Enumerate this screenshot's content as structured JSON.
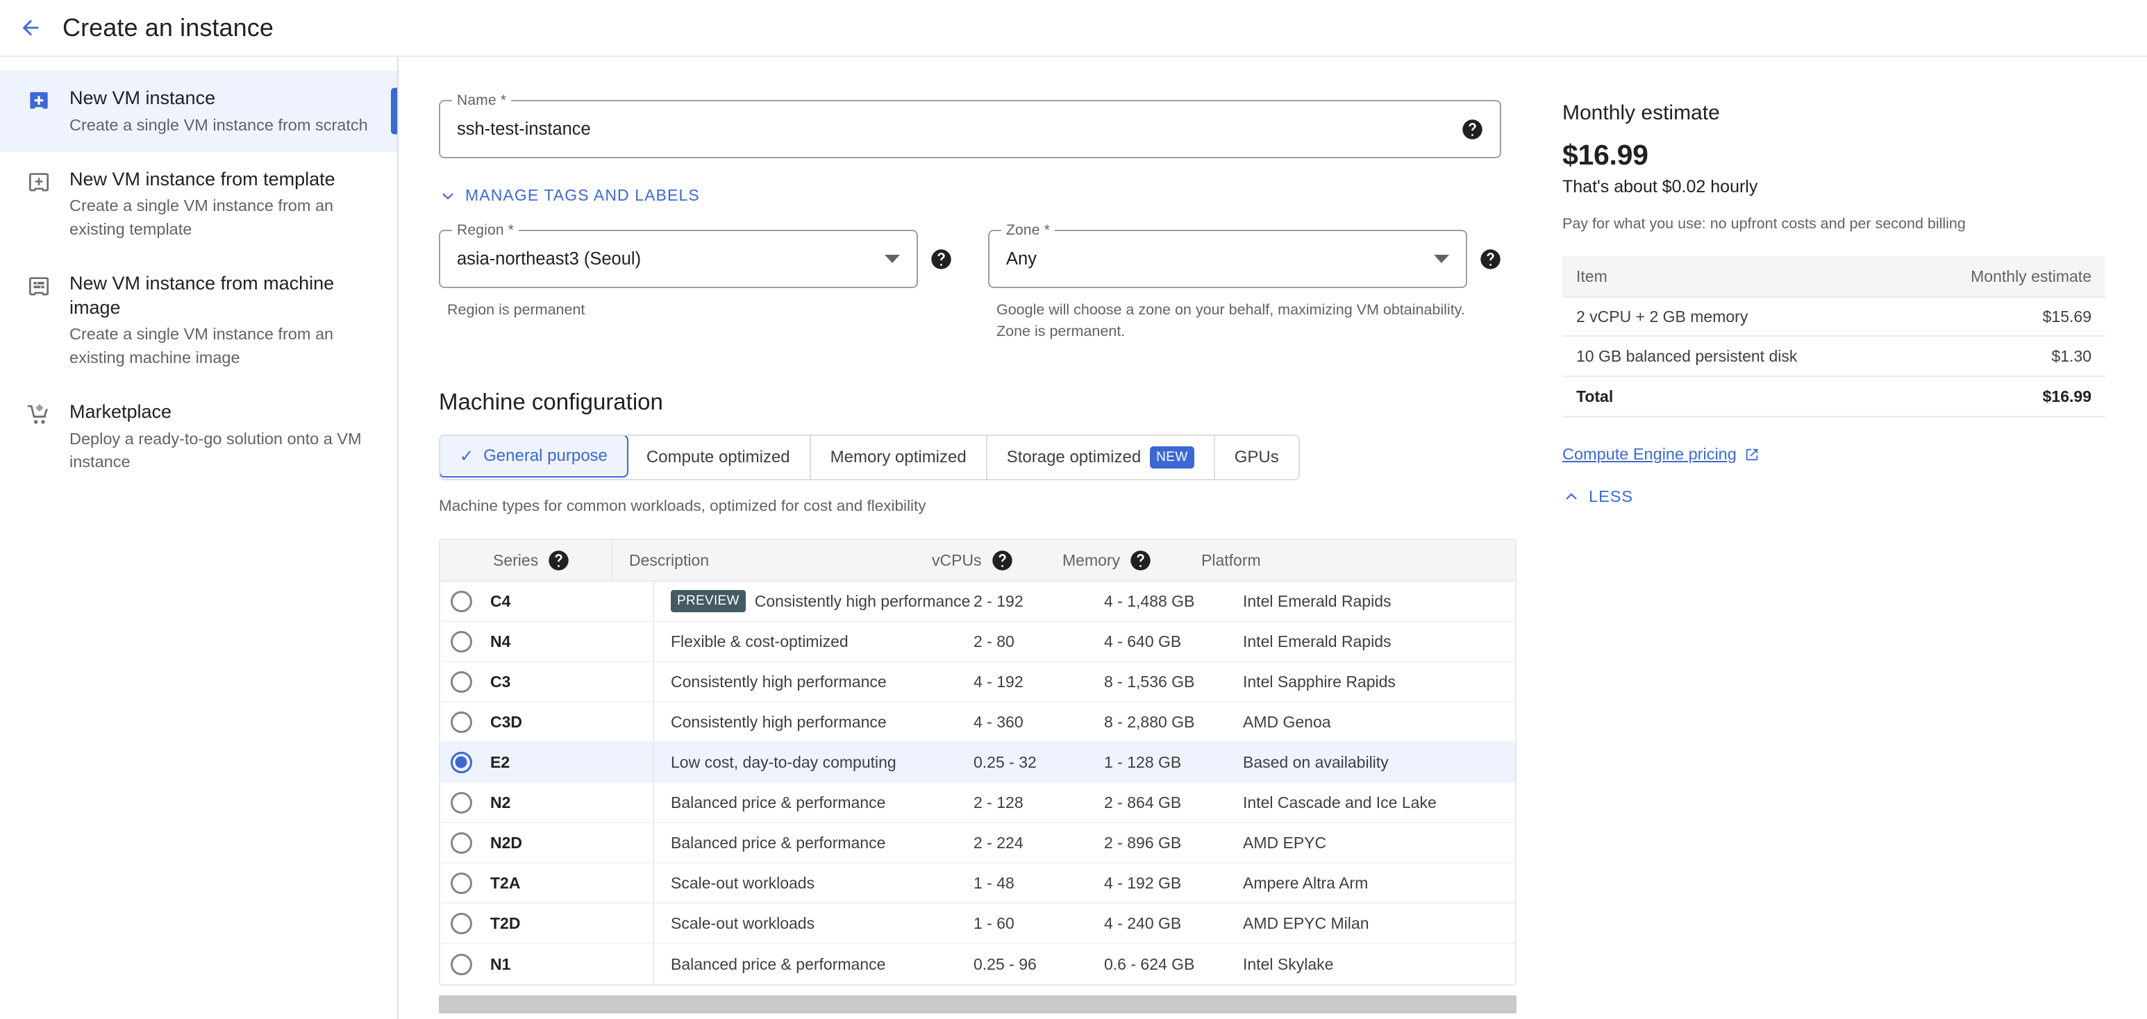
{
  "header": {
    "title": "Create an instance",
    "back_icon": "arrow-back-icon"
  },
  "sidebar": {
    "items": [
      {
        "icon": "vm-add-icon",
        "title": "New VM instance",
        "desc": "Create a single VM instance from scratch",
        "active": true
      },
      {
        "icon": "vm-template-icon",
        "title": "New VM instance from template",
        "desc": "Create a single VM instance from an existing template",
        "active": false
      },
      {
        "icon": "machine-image-icon",
        "title": "New VM instance from machine image",
        "desc": "Create a single VM instance from an existing machine image",
        "active": false
      },
      {
        "icon": "shopping-cart-icon",
        "title": "Marketplace",
        "desc": "Deploy a ready-to-go solution onto a VM instance",
        "active": false
      }
    ]
  },
  "form": {
    "name": {
      "label": "Name *",
      "value": "ssh-test-instance",
      "help_icon": "help-icon"
    },
    "manage_tags_link": "MANAGE TAGS AND LABELS",
    "region": {
      "label": "Region *",
      "value": "asia-northeast3 (Seoul)",
      "hint": "Region is permanent",
      "help_icon": "help-icon"
    },
    "zone": {
      "label": "Zone *",
      "value": "Any",
      "hint": "Google will choose a zone on your behalf, maximizing VM obtainability. Zone is permanent.",
      "help_icon": "help-icon"
    }
  },
  "machine_config": {
    "title": "Machine configuration",
    "tabs": [
      {
        "label": "General purpose",
        "selected": true,
        "badge": null
      },
      {
        "label": "Compute optimized",
        "selected": false,
        "badge": null
      },
      {
        "label": "Memory optimized",
        "selected": false,
        "badge": null
      },
      {
        "label": "Storage optimized",
        "selected": false,
        "badge": "NEW"
      },
      {
        "label": "GPUs",
        "selected": false,
        "badge": null
      }
    ],
    "tabs_hint": "Machine types for common workloads, optimized for cost and flexibility",
    "table": {
      "columns": [
        "Series",
        "Description",
        "vCPUs",
        "Memory",
        "Platform"
      ],
      "rows": [
        {
          "series": "C4",
          "badge": "PREVIEW",
          "description": "Consistently high performance",
          "vcpus": "2 - 192",
          "memory": "4 - 1,488 GB",
          "platform": "Intel Emerald Rapids",
          "selected": false
        },
        {
          "series": "N4",
          "badge": null,
          "description": "Flexible & cost-optimized",
          "vcpus": "2 - 80",
          "memory": "4 - 640 GB",
          "platform": "Intel Emerald Rapids",
          "selected": false
        },
        {
          "series": "C3",
          "badge": null,
          "description": "Consistently high performance",
          "vcpus": "4 - 192",
          "memory": "8 - 1,536 GB",
          "platform": "Intel Sapphire Rapids",
          "selected": false
        },
        {
          "series": "C3D",
          "badge": null,
          "description": "Consistently high performance",
          "vcpus": "4 - 360",
          "memory": "8 - 2,880 GB",
          "platform": "AMD Genoa",
          "selected": false
        },
        {
          "series": "E2",
          "badge": null,
          "description": "Low cost, day-to-day computing",
          "vcpus": "0.25 - 32",
          "memory": "1 - 128 GB",
          "platform": "Based on availability",
          "selected": true
        },
        {
          "series": "N2",
          "badge": null,
          "description": "Balanced price & performance",
          "vcpus": "2 - 128",
          "memory": "2 - 864 GB",
          "platform": "Intel Cascade and Ice Lake",
          "selected": false
        },
        {
          "series": "N2D",
          "badge": null,
          "description": "Balanced price & performance",
          "vcpus": "2 - 224",
          "memory": "2 - 896 GB",
          "platform": "AMD EPYC",
          "selected": false
        },
        {
          "series": "T2A",
          "badge": null,
          "description": "Scale-out workloads",
          "vcpus": "1 - 48",
          "memory": "4 - 192 GB",
          "platform": "Ampere Altra Arm",
          "selected": false
        },
        {
          "series": "T2D",
          "badge": null,
          "description": "Scale-out workloads",
          "vcpus": "1 - 60",
          "memory": "4 - 240 GB",
          "platform": "AMD EPYC Milan",
          "selected": false
        },
        {
          "series": "N1",
          "badge": null,
          "description": "Balanced price & performance",
          "vcpus": "0.25 - 96",
          "memory": "0.6 - 624 GB",
          "platform": "Intel Skylake",
          "selected": false
        }
      ]
    }
  },
  "estimate": {
    "title": "Monthly estimate",
    "price": "$16.99",
    "hourly": "That's about $0.02 hourly",
    "note": "Pay for what you use: no upfront costs and per second billing",
    "col_item": "Item",
    "col_estimate": "Monthly estimate",
    "rows": [
      {
        "item": "2 vCPU + 2 GB memory",
        "value": "$15.69"
      },
      {
        "item": "10 GB balanced persistent disk",
        "value": "$1.30"
      },
      {
        "item": "Total",
        "value": "$16.99"
      }
    ],
    "pricing_link": "Compute Engine pricing",
    "less_link": "LESS"
  },
  "colors": {
    "accent": "#3c68d4",
    "accent_bg": "#eef3fd",
    "badge_preview": "#455a64",
    "text_primary": "#202124",
    "text_secondary": "#5f6368"
  }
}
